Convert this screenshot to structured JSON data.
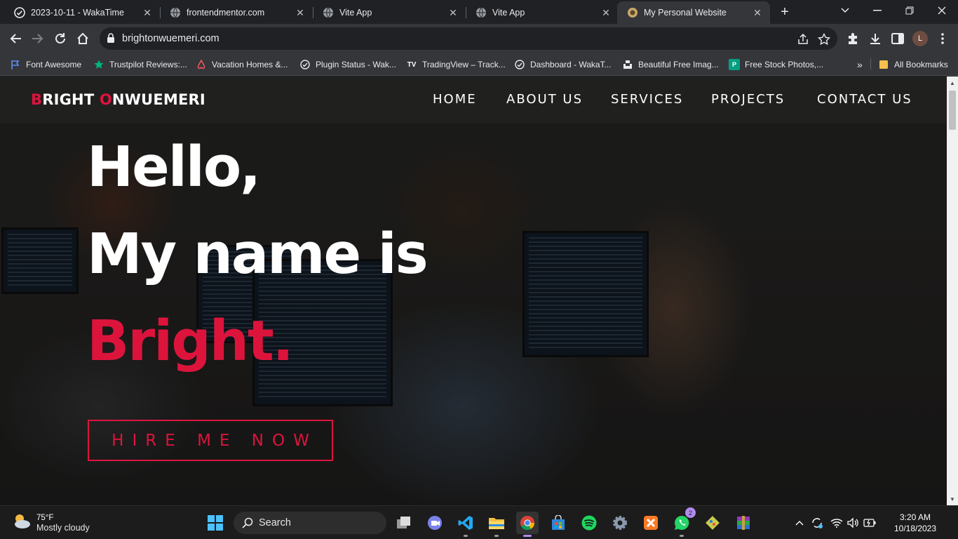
{
  "browser": {
    "tabs": [
      {
        "title": "2023-10-11 - WakaTime",
        "favicon": "wakatime-icon",
        "active": false
      },
      {
        "title": "frontendmentor.com",
        "favicon": "globe-icon",
        "active": false
      },
      {
        "title": "Vite App",
        "favicon": "globe-icon",
        "active": false
      },
      {
        "title": "Vite App",
        "favicon": "globe-icon",
        "active": false
      },
      {
        "title": "My Personal Website",
        "favicon": "site-icon",
        "active": true
      }
    ],
    "url": "brightonwuemeri.com",
    "profile_initial": "L",
    "bookmarks": [
      {
        "label": "Font Awesome",
        "icon": "flag-icon"
      },
      {
        "label": "Trustpilot Reviews:...",
        "icon": "star-icon"
      },
      {
        "label": "Vacation Homes &...",
        "icon": "airbnb-icon"
      },
      {
        "label": "Plugin Status - Wak...",
        "icon": "wakatime-icon"
      },
      {
        "label": "TradingView – Track...",
        "icon": "tradingview-icon"
      },
      {
        "label": "Dashboard - WakaT...",
        "icon": "wakatime-icon"
      },
      {
        "label": "Beautiful Free Imag...",
        "icon": "unsplash-icon"
      },
      {
        "label": "Free Stock Photos,...",
        "icon": "pexels-icon"
      }
    ],
    "more_bookmarks": "»",
    "all_bookmarks": "All Bookmarks"
  },
  "site": {
    "logo": {
      "first_initial": "B",
      "first_rest": "RIGHT ",
      "last_initial": "O",
      "last_rest": "NWUEMERI"
    },
    "nav": [
      "HOME",
      "ABOUT US",
      "SERVICES",
      "PROJECTS",
      "CONTACT US"
    ],
    "hero": {
      "line1": "Hello,",
      "line2": "My name is",
      "line3": "Bright."
    },
    "cta": "HIRE ME NOW",
    "accent_color": "#dc143c"
  },
  "taskbar": {
    "weather": {
      "temp": "75°F",
      "condition": "Mostly cloudy"
    },
    "search_label": "Search",
    "apps": [
      "windows-start-icon",
      "task-view-icon",
      "teams-meet-icon",
      "vscode-icon",
      "file-explorer-icon",
      "chrome-icon",
      "microsoft-store-icon",
      "spotify-icon",
      "settings-icon",
      "xampp-icon",
      "whatsapp-icon",
      "git-icon",
      "winrar-icon"
    ],
    "whatsapp_badge": "2",
    "time": "3:20 AM",
    "date": "10/18/2023"
  }
}
